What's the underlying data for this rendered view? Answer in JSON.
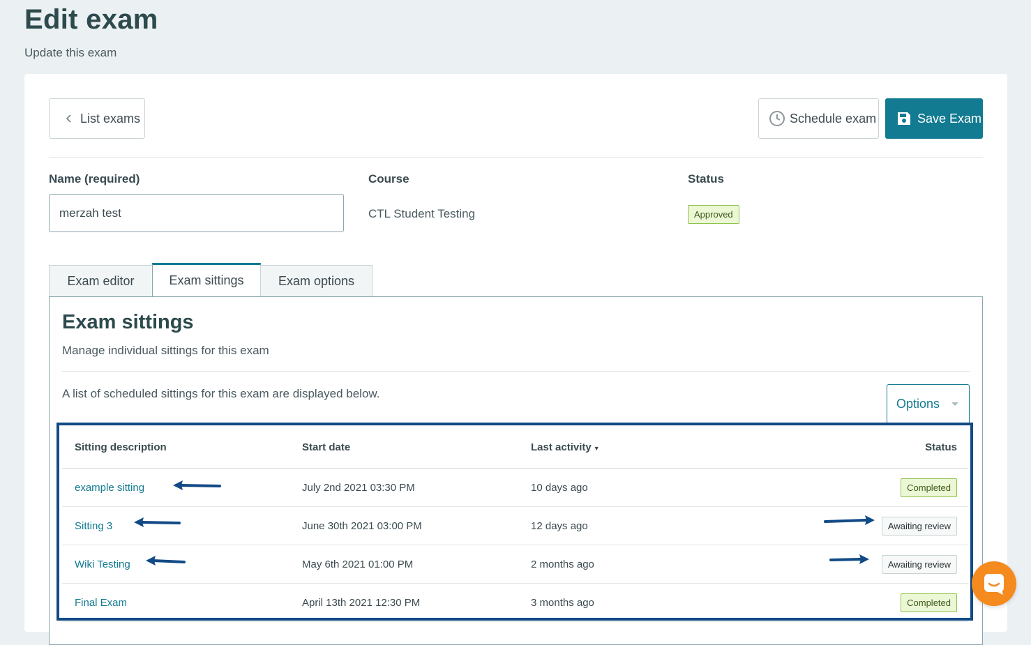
{
  "header": {
    "title": "Edit exam",
    "subtitle": "Update this exam"
  },
  "toolbar": {
    "list_label": "List exams",
    "schedule_label": "Schedule exam",
    "save_label": "Save Exam"
  },
  "form": {
    "name_label": "Name (required)",
    "name_value": "merzah test",
    "course_label": "Course",
    "course_value": "CTL Student Testing",
    "status_label": "Status",
    "status_value": "Approved"
  },
  "tabs": [
    {
      "label": "Exam editor",
      "active": false
    },
    {
      "label": "Exam sittings",
      "active": true
    },
    {
      "label": "Exam options",
      "active": false
    }
  ],
  "panel": {
    "title": "Exam sittings",
    "subtitle": "Manage individual sittings for this exam",
    "description": "A list of scheduled sittings for this exam are displayed below.",
    "options_label": "Options"
  },
  "table": {
    "headers": {
      "description": "Sitting description",
      "start": "Start date",
      "last": "Last activity",
      "status": "Status"
    },
    "rows": [
      {
        "description": "example sitting",
        "start": "July 2nd 2021 03:30 PM",
        "last": "10 days ago",
        "status": "Completed"
      },
      {
        "description": "Sitting 3",
        "start": "June 30th 2021 03:00 PM",
        "last": "12 days ago",
        "status": "Awaiting review"
      },
      {
        "description": "Wiki Testing",
        "start": "May 6th 2021 01:00 PM",
        "last": "2 months ago",
        "status": "Awaiting review"
      },
      {
        "description": "Final Exam",
        "start": "April 13th 2021 12:30 PM",
        "last": "3 months ago",
        "status": "Completed"
      }
    ]
  },
  "colors": {
    "accent": "#127a91",
    "title": "#2d4a4d",
    "annotation": "#124a85",
    "approved_bg": "#ecf7d6",
    "approved_border": "#8fc24a",
    "chat": "#f58a1f"
  },
  "icons": [
    "chevron-left-icon",
    "clock-icon",
    "save-icon",
    "caret-down-icon",
    "sort-down-icon",
    "chat-icon"
  ]
}
